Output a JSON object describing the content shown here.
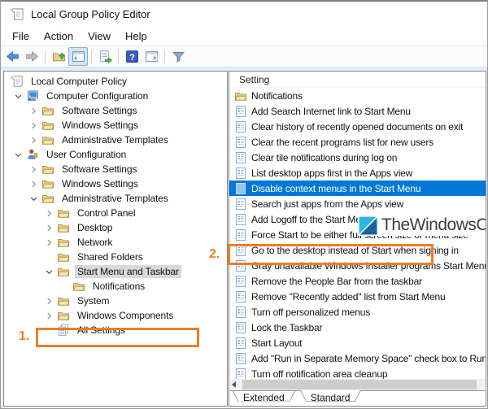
{
  "window": {
    "title": "Local Group Policy Editor"
  },
  "menubar": {
    "items": [
      "File",
      "Action",
      "View",
      "Help"
    ]
  },
  "toolbar": {
    "buttons": [
      {
        "name": "back-button",
        "icon": "arrow-left-icon"
      },
      {
        "name": "forward-button",
        "icon": "arrow-right-icon"
      },
      {
        "sep": true
      },
      {
        "name": "parent-folder-button",
        "icon": "folder-up-icon"
      },
      {
        "name": "show-console-tree-button",
        "icon": "console-tree-icon",
        "pressed": true
      },
      {
        "sep": true
      },
      {
        "name": "export-list-button",
        "icon": "export-list-icon"
      },
      {
        "sep": true
      },
      {
        "name": "help-button",
        "icon": "help-icon"
      },
      {
        "name": "show-action-pane-button",
        "icon": "action-pane-icon"
      },
      {
        "sep": true
      },
      {
        "name": "filter-button",
        "icon": "filter-icon"
      }
    ]
  },
  "tree": {
    "items": [
      {
        "label": "Local Computer Policy",
        "level": 0,
        "toggle": "none",
        "icon": "scroll-icon"
      },
      {
        "label": "Computer Configuration",
        "level": 1,
        "toggle": "expanded",
        "icon": "computer-icon"
      },
      {
        "label": "Software Settings",
        "level": 2,
        "toggle": "collapsed",
        "icon": "folder-icon"
      },
      {
        "label": "Windows Settings",
        "level": 2,
        "toggle": "collapsed",
        "icon": "folder-icon"
      },
      {
        "label": "Administrative Templates",
        "level": 2,
        "toggle": "collapsed",
        "icon": "folder-icon"
      },
      {
        "label": "User Configuration",
        "level": 1,
        "toggle": "expanded",
        "icon": "user-icon"
      },
      {
        "label": "Software Settings",
        "level": 2,
        "toggle": "collapsed",
        "icon": "folder-icon"
      },
      {
        "label": "Windows Settings",
        "level": 2,
        "toggle": "collapsed",
        "icon": "folder-icon"
      },
      {
        "label": "Administrative Templates",
        "level": 2,
        "toggle": "expanded",
        "icon": "folder-icon"
      },
      {
        "label": "Control Panel",
        "level": 3,
        "toggle": "collapsed",
        "icon": "folder-icon"
      },
      {
        "label": "Desktop",
        "level": 3,
        "toggle": "collapsed",
        "icon": "folder-icon"
      },
      {
        "label": "Network",
        "level": 3,
        "toggle": "collapsed",
        "icon": "folder-icon"
      },
      {
        "label": "Shared Folders",
        "level": 3,
        "toggle": "none",
        "icon": "folder-icon"
      },
      {
        "label": "Start Menu and Taskbar",
        "level": 3,
        "toggle": "expanded",
        "icon": "folder-icon",
        "selected": true
      },
      {
        "label": "Notifications",
        "level": 4,
        "toggle": "none",
        "icon": "folder-icon"
      },
      {
        "label": "System",
        "level": 3,
        "toggle": "collapsed",
        "icon": "folder-icon"
      },
      {
        "label": "Windows Components",
        "level": 3,
        "toggle": "collapsed",
        "icon": "folder-icon"
      },
      {
        "label": "All Settings",
        "level": 3,
        "toggle": "none",
        "icon": "all-settings-icon"
      }
    ]
  },
  "list": {
    "column_header": "Setting",
    "items": [
      {
        "label": "Notifications",
        "icon": "folder-icon"
      },
      {
        "label": "Add Search Internet link to Start Menu",
        "icon": "policy-icon"
      },
      {
        "label": "Clear history of recently opened documents on exit",
        "icon": "policy-icon"
      },
      {
        "label": "Clear the recent programs list for new users",
        "icon": "policy-icon"
      },
      {
        "label": "Clear tile notifications during log on",
        "icon": "policy-icon"
      },
      {
        "label": "List desktop apps first in the Apps view",
        "icon": "policy-icon"
      },
      {
        "label": "Disable context menus in the Start Menu",
        "icon": "policy-selected-icon",
        "selected": true
      },
      {
        "label": "Search just apps from the Apps view",
        "icon": "policy-icon"
      },
      {
        "label": "Add Logoff to the Start Menu",
        "icon": "policy-icon"
      },
      {
        "label": "Force Start to be either full screen size or menu size",
        "icon": "policy-icon"
      },
      {
        "label": "Go to the desktop instead of Start when signing in",
        "icon": "policy-icon"
      },
      {
        "label": "Gray unavailable Windows Installer programs Start Menu",
        "icon": "policy-icon"
      },
      {
        "label": "Remove the People Bar from the taskbar",
        "icon": "policy-icon"
      },
      {
        "label": "Remove \"Recently added\" list from Start Menu",
        "icon": "policy-icon"
      },
      {
        "label": "Turn off personalized menus",
        "icon": "policy-icon"
      },
      {
        "label": "Lock the Taskbar",
        "icon": "policy-icon"
      },
      {
        "label": "Start Layout",
        "icon": "policy-icon"
      },
      {
        "label": "Add \"Run in Separate Memory Space\" check box to Run",
        "icon": "policy-icon"
      },
      {
        "label": "Turn off notification area cleanup",
        "icon": "policy-icon"
      }
    ]
  },
  "watermark": {
    "text": "TheWindowsClub",
    "logo": "thewindowsclub-logo"
  },
  "tabs": {
    "items": [
      {
        "label": "Extended"
      },
      {
        "label": "Standard",
        "active": true
      }
    ]
  },
  "annotations": {
    "step1": {
      "label": "1.",
      "target": "Start Menu and Taskbar"
    },
    "step2": {
      "label": "2.",
      "target": "Disable context menus in the Start Menu"
    }
  },
  "colors": {
    "selection_blue": "#0078d7",
    "annotation_orange": "#ed7d22",
    "tree_inactive_selection": "#d8d8d8"
  }
}
